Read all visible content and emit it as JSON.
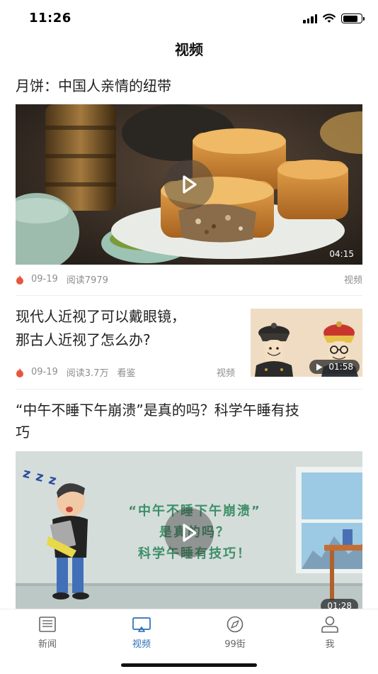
{
  "status_bar": {
    "time": "11:26"
  },
  "nav": {
    "title": "视频"
  },
  "feed": {
    "item1": {
      "title": "月饼：中国人亲情的纽带",
      "duration": "04:15",
      "date": "09-19",
      "reads": "阅读7979",
      "category": "视频"
    },
    "item2": {
      "title_line1": "现代人近视了可以戴眼镜，",
      "title_line2": "那古人近视了怎么办?",
      "duration": "01:58",
      "date": "09-19",
      "reads": "阅读3.7万",
      "source": "看鉴",
      "category": "视频"
    },
    "item3": {
      "title_line1": "“中午不睡下午崩溃”是真的吗？科学午睡有技",
      "title_line2": "巧",
      "poster_line1": "“中午不睡下午崩溃”",
      "poster_line2": "是真的吗？",
      "poster_line3": "科学午睡有技巧！",
      "zzz": "z z z",
      "duration": "01:28"
    }
  },
  "tabs": [
    {
      "label": "新闻",
      "icon": "news-icon",
      "active": false
    },
    {
      "label": "视频",
      "icon": "video-icon",
      "active": true
    },
    {
      "label": "99街",
      "icon": "compass-icon",
      "active": false
    },
    {
      "label": "我",
      "icon": "profile-icon",
      "active": false
    }
  ],
  "colors": {
    "accent": "#2c6fb8",
    "meta_text": "#8d8d8d",
    "hot_icon": "#e8553e"
  }
}
